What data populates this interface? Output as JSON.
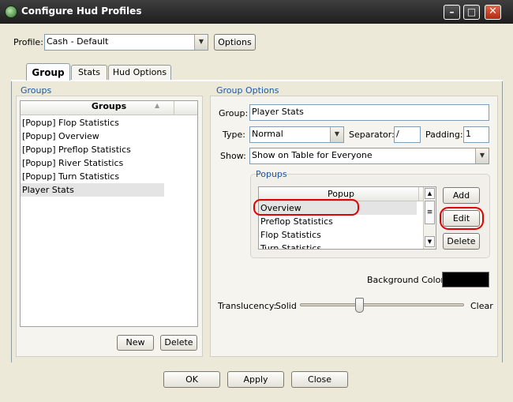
{
  "window": {
    "title": "Configure Hud Profiles"
  },
  "profile": {
    "label": "Profile:",
    "value": "Cash - Default",
    "options_button": "Options"
  },
  "tabs": [
    {
      "label": "Group"
    },
    {
      "label": "Stats"
    },
    {
      "label": "Hud Options"
    }
  ],
  "groups_panel": {
    "legend": "Groups",
    "column_header": "Groups",
    "items": [
      "[Popup] Flop Statistics",
      "[Popup] Overview",
      "[Popup] Preflop Statistics",
      "[Popup] River Statistics",
      "[Popup] Turn Statistics",
      "Player Stats"
    ],
    "selected_index": 5,
    "new_button": "New",
    "delete_button": "Delete"
  },
  "group_options": {
    "legend": "Group Options",
    "group_label": "Group:",
    "group_value": "Player Stats",
    "type_label": "Type:",
    "type_value": "Normal",
    "separator_label": "Separator:",
    "separator_value": "/",
    "padding_label": "Padding:",
    "padding_value": "1",
    "show_label": "Show:",
    "show_value": "Show on Table for Everyone",
    "popups": {
      "legend": "Popups",
      "column_header": "Popup",
      "items": [
        "Overview",
        "Preflop Statistics",
        "Flop Statistics",
        "Turn Statistics"
      ],
      "selected_index": 0,
      "add_button": "Add",
      "edit_button": "Edit",
      "delete_button": "Delete"
    },
    "background_color_label": "Background Color:",
    "background_color": "#000000",
    "translucency_label": "Translucency:",
    "translucency_min": "Solid",
    "translucency_max": "Clear",
    "translucency_value": 0.36
  },
  "footer": {
    "ok": "OK",
    "apply": "Apply",
    "close": "Close"
  },
  "colors": {
    "accent_text": "#1c58a6",
    "highlight_ring": "#e00000"
  }
}
